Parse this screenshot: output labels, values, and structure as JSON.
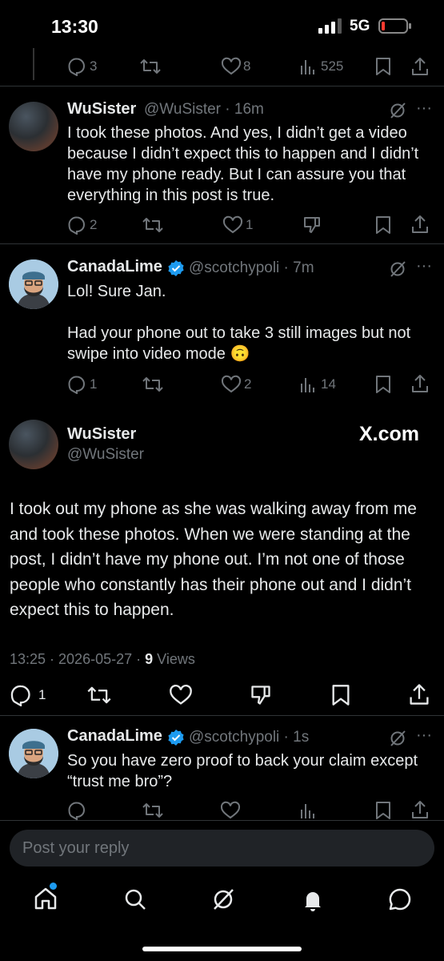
{
  "status_bar": {
    "time": "13:30",
    "network": "5G"
  },
  "top_actions": {
    "replies": "3",
    "likes": "8",
    "views": "525"
  },
  "reply1": {
    "name": "WuSister",
    "handle": "@WuSister",
    "time": "16m",
    "text": "I took these photos. And yes, I didn’t get a video because I didn’t expect this to happen and I didn’t have my phone ready. But I can assure you that everything in this post is true.",
    "replies": "2",
    "likes": "1"
  },
  "reply2": {
    "name": "CanadaLime",
    "handle": "@scotchypoli",
    "time": "7m",
    "text_line1": "Lol! Sure Jan.",
    "text_line2": "Had your phone out to take 3 still images but not swipe into video mode 🙃",
    "replies": "1",
    "likes": "2",
    "views": "14"
  },
  "main_post": {
    "name": "WuSister",
    "handle": "@WuSister",
    "brand": "X.com",
    "text": "I took out my phone as she was walking away from me and took these photos. When we were standing at the post, I didn’t have my phone out. I’m not one of those people who constantly has their phone out and I didn’t expect this to happen.",
    "timestamp": "13:25 · 2026-05-27 · ",
    "views_count": "9",
    "views_label": " Views",
    "replies": "1"
  },
  "reply3": {
    "name": "CanadaLime",
    "handle": "@scotchypoli",
    "time": "1s",
    "text": "So you have zero proof to back your claim except “trust me bro”?"
  },
  "composer": {
    "placeholder": "Post your reply"
  },
  "nav": [
    "home-icon",
    "search-icon",
    "grok-icon",
    "notifications-icon",
    "messages-icon"
  ],
  "colors": {
    "accent": "#1d9bf0",
    "background": "#000000",
    "muted": "#71767b",
    "divider": "#2f3336"
  }
}
